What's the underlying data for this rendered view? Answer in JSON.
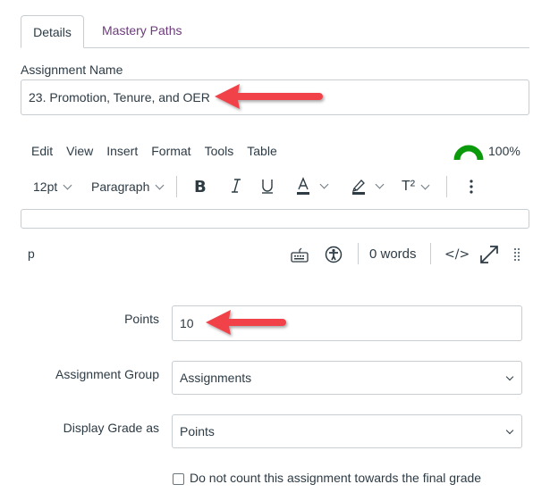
{
  "tabs": [
    {
      "label": "Details",
      "active": true
    },
    {
      "label": "Mastery Paths",
      "active": false
    }
  ],
  "assignment_name": {
    "label": "Assignment Name",
    "value": "23. Promotion, Tenure, and OER"
  },
  "editor": {
    "menu": [
      "Edit",
      "View",
      "Insert",
      "Format",
      "Tools",
      "Table"
    ],
    "accessibility_score": "100%",
    "toolbar": {
      "font_size": "12pt",
      "block_format": "Paragraph",
      "superscript_label": "T²"
    },
    "status": {
      "path": "p",
      "word_count": "0 words",
      "html_toggle": "</>"
    },
    "colors": {
      "gauge": "#0b9a0b"
    }
  },
  "form": {
    "points": {
      "label": "Points",
      "value": "10"
    },
    "assignment_group": {
      "label": "Assignment Group",
      "selected": "Assignments"
    },
    "display_grade_as": {
      "label": "Display Grade as",
      "selected": "Points"
    },
    "omit_from_final_grade": {
      "label": "Do not count this assignment towards the final grade",
      "checked": false
    }
  },
  "annotations": {
    "arrow_color": "#f2424a"
  }
}
